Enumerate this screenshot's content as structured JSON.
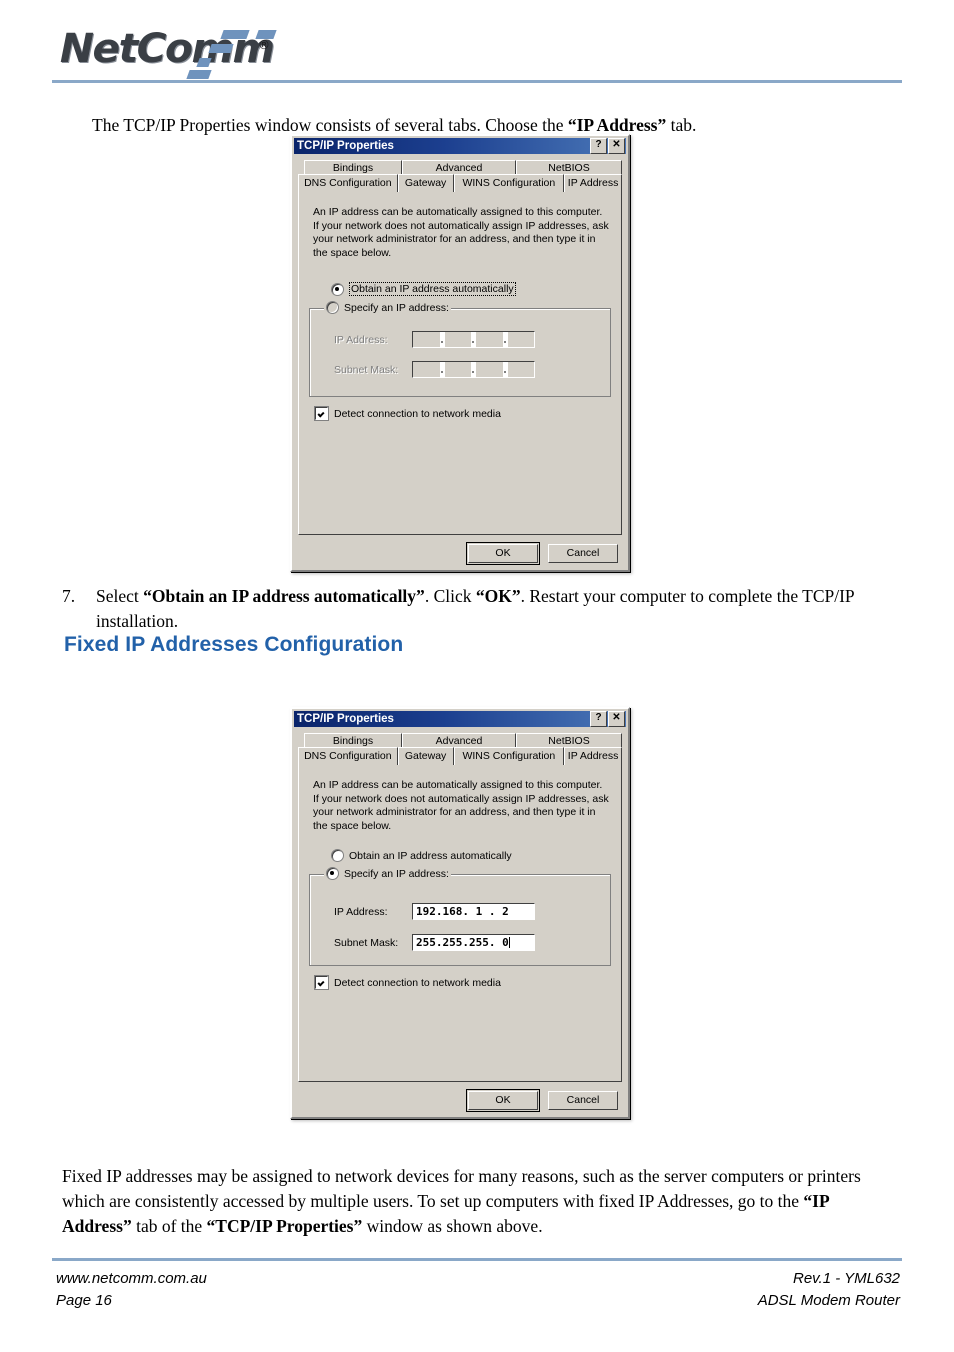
{
  "header": {
    "logo_text": "NetComm",
    "registered_mark": "®"
  },
  "intro_paragraph": {
    "part1": "The TCP/IP Properties window consists of several tabs. Choose the ",
    "bold1": "“IP Address”",
    "part2": " tab."
  },
  "step7": {
    "number": "7.",
    "part1": "Select ",
    "bold1": "“Obtain an IP address automatically”",
    "part2": ". Click ",
    "bold2": "“OK”",
    "part3": ". Restart your computer to complete the TCP/IP installation."
  },
  "section_heading": "Fixed IP Addresses Configuration",
  "bottom_paragraph": {
    "part1": "Fixed IP addresses may be assigned to network devices for many reasons, such as the server computers or printers which are consistently accessed by multiple users. To set up computers with fixed IP Addresses, go to the ",
    "bold1": "“IP Address”",
    "part2": " tab of the ",
    "bold2": "“TCP/IP Properties”",
    "part3": " window as shown above."
  },
  "footer": {
    "website": "www.netcomm.com.au",
    "page": "Page 16",
    "revision": "Rev.1 - YML632",
    "product": "ADSL Modem Router"
  },
  "dialog1": {
    "title": "TCP/IP Properties",
    "help_button": "?",
    "close_button": "✕",
    "tabs_row1": [
      "Bindings",
      "Advanced",
      "NetBIOS"
    ],
    "tabs_row2": [
      "DNS Configuration",
      "Gateway",
      "WINS Configuration",
      "IP Address"
    ],
    "active_tab": "IP Address",
    "description": "An IP address can be automatically assigned to this computer. If your network does not automatically assign IP addresses, ask your network administrator for an address, and then type it in the space below.",
    "radio_auto": "Obtain an IP address automatically",
    "radio_specify": "Specify an IP address:",
    "selected_radio": "auto",
    "ip_address_label": "IP Address:",
    "subnet_mask_label": "Subnet Mask:",
    "ip_address_value": "",
    "subnet_mask_value": "",
    "fields_enabled": false,
    "detect_checkbox_label": "Detect connection to network media",
    "detect_checked": true,
    "ok_button": "OK",
    "cancel_button": "Cancel"
  },
  "dialog2": {
    "title": "TCP/IP Properties",
    "help_button": "?",
    "close_button": "✕",
    "tabs_row1": [
      "Bindings",
      "Advanced",
      "NetBIOS"
    ],
    "tabs_row2": [
      "DNS Configuration",
      "Gateway",
      "WINS Configuration",
      "IP Address"
    ],
    "active_tab": "IP Address",
    "description": "An IP address can be automatically assigned to this computer. If your network does not automatically assign IP addresses, ask your network administrator for an address, and then type it in the space below.",
    "radio_auto": "Obtain an IP address automatically",
    "radio_specify": "Specify an IP address:",
    "selected_radio": "specify",
    "ip_address_label": "IP Address:",
    "subnet_mask_label": "Subnet Mask:",
    "ip_address_value": "192.168. 1 . 2",
    "subnet_mask_value": "255.255.255. 0",
    "fields_enabled": true,
    "detect_checkbox_label": "Detect connection to network media",
    "detect_checked": true,
    "ok_button": "OK",
    "cancel_button": "Cancel"
  },
  "colors": {
    "heading_blue": "#2261a9",
    "rule_blue": "#8aa8c8",
    "titlebar_dark": "#0a246a",
    "titlebar_light": "#4a77b8",
    "dialog_face": "#d4d0c8",
    "logo_accent": "#6f93bd"
  }
}
